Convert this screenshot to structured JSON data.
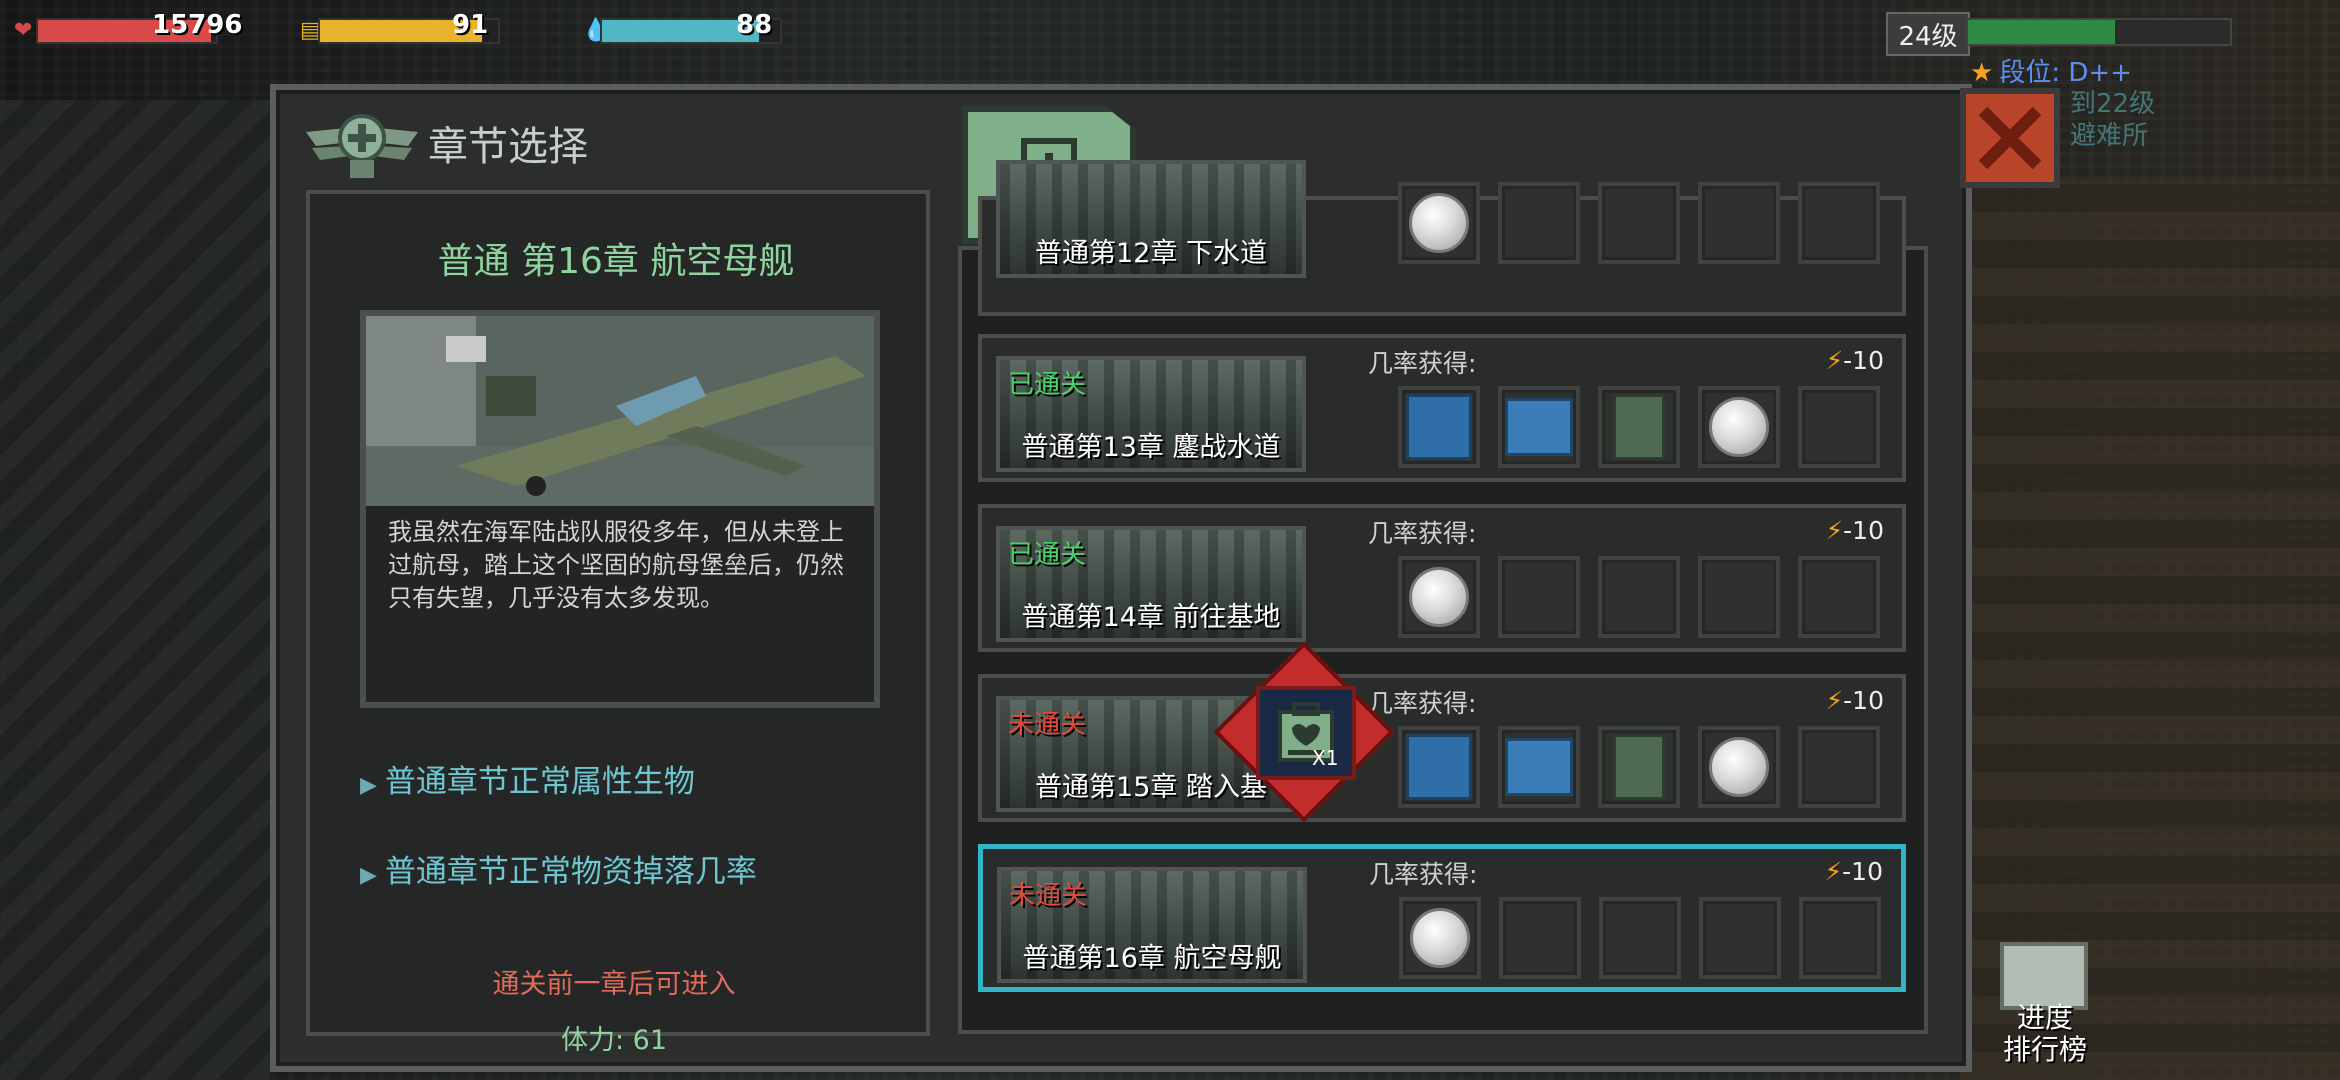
{
  "hud": {
    "health": {
      "icon": "heart-icon",
      "value": "15796",
      "fill_percent": 97,
      "color": "#d84a4a"
    },
    "food": {
      "icon": "food-icon",
      "value": "91",
      "fill_percent": 91,
      "color": "#e8b32a"
    },
    "water": {
      "icon": "water-icon",
      "value": "88",
      "fill_percent": 88,
      "color": "#4fb8c4"
    },
    "level": "24级",
    "xp_fill_percent": 56,
    "rank": "段位: D++",
    "ghost_line1": "到22级",
    "ghost_line2": "避难所"
  },
  "panel": {
    "title": "章节选择",
    "selected_chapter": "普通 第16章 航空母舰",
    "description": "我虽然在海军陆战队服役多年，但从未登上过航母，踏上这个坚固的航母堡垒后，仍然只有失望，几乎没有太多发现。",
    "bullet1": "普通章节正常属性生物",
    "bullet2": "普通章节正常物资掉落几率",
    "unlock_hint": "通关前一章后可进入",
    "stamina": "体力: 61"
  },
  "chapters": [
    {
      "name": "普通第12章 下水道",
      "status": "",
      "status_color": "#4bd36a",
      "drop_label": "",
      "cost": "",
      "items": [
        "coin",
        "empty",
        "empty",
        "empty",
        "empty"
      ]
    },
    {
      "name": "普通第13章 鏖战水道",
      "status": "已通关",
      "status_color": "#4bd36a",
      "drop_label": "几率获得:",
      "cost": "-10",
      "items": [
        "armor",
        "gun",
        "ammo",
        "coin",
        "empty"
      ]
    },
    {
      "name": "普通第14章 前往基地",
      "status": "已通关",
      "status_color": "#4bd36a",
      "drop_label": "几率获得:",
      "cost": "-10",
      "items": [
        "coin",
        "empty",
        "empty",
        "empty",
        "empty"
      ]
    },
    {
      "name": "普通第15章 踏入基",
      "status": "未通关",
      "status_color": "#e04a3a",
      "drop_label": "几率获得:",
      "cost": "-10",
      "items": [
        "armor",
        "gun",
        "ammo",
        "coin",
        "empty"
      ]
    },
    {
      "name": "普通第16章 航空母舰",
      "status": "未通关",
      "status_color": "#e04a3a",
      "drop_label": "几率获得:",
      "cost": "-10",
      "items": [
        "coin",
        "empty",
        "empty",
        "empty",
        "empty"
      ]
    }
  ],
  "reward_badge": {
    "icon": "medkit-icon",
    "count": "X1"
  },
  "leaderboard": {
    "line1": "进度",
    "line2": "排行榜"
  }
}
